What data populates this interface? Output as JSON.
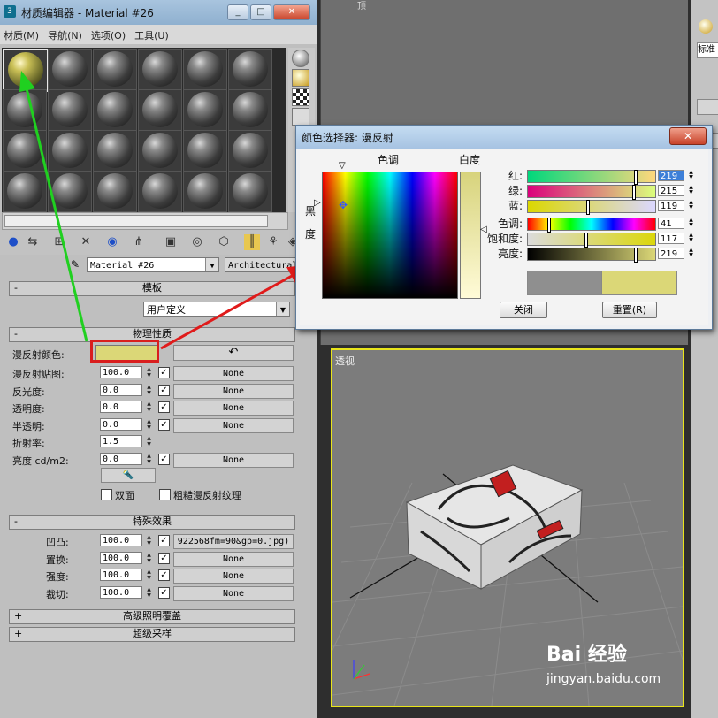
{
  "material_editor": {
    "title": "材质编辑器 - Material #26",
    "menu": [
      "材质(M)",
      "导航(N)",
      "选项(O)",
      "工具(U)"
    ],
    "material_name": "Material #26",
    "material_type": "Architectural",
    "template_rollout": "模板",
    "template_value": "用户定义",
    "physical_rollout": "物理性质",
    "diffuse_color_label": "漫反射颜色:",
    "diffuse_color": "#dbd777",
    "params": [
      {
        "label": "漫反射贴图:",
        "value": "100.0",
        "map": "None"
      },
      {
        "label": "反光度:",
        "value": "0.0",
        "map": "None"
      },
      {
        "label": "透明度:",
        "value": "0.0",
        "map": "None"
      },
      {
        "label": "半透明:",
        "value": "0.0",
        "map": "None"
      },
      {
        "label": "折射率:",
        "value": "1.5",
        "map": ""
      },
      {
        "label": "亮度 cd/m2:",
        "value": "0.0",
        "map": "None"
      }
    ],
    "double_sided": "双面",
    "rough_diffuse": "粗糙漫反射纹理",
    "special_rollout": "特殊效果",
    "special": [
      {
        "label": "凹凸:",
        "value": "100.0",
        "map": "922568fm=90&gp=0.jpg)"
      },
      {
        "label": "置换:",
        "value": "100.0",
        "map": "None"
      },
      {
        "label": "强度:",
        "value": "100.0",
        "map": "None"
      },
      {
        "label": "裁切:",
        "value": "100.0",
        "map": "None"
      }
    ],
    "adv_lighting": "高级照明覆盖",
    "supersampling": "超级采样"
  },
  "viewport": {
    "perspective_label": "透视",
    "top_label": "顶"
  },
  "right_panel": {
    "label": "标准"
  },
  "color_picker": {
    "title": "颜色选择器: 漫反射",
    "hue_label": "色调",
    "whiteness_label": "白度",
    "black_label_1": "黑",
    "black_label_2": "度",
    "channels": [
      {
        "label": "红:",
        "value": "219",
        "gradient": "linear-gradient(to right,#00d77c,#ffd77c)",
        "pos": 0.86
      },
      {
        "label": "绿:",
        "value": "215",
        "gradient": "linear-gradient(to right,#db007c,#dbff7c)",
        "pos": 0.84
      },
      {
        "label": "蓝:",
        "value": "119",
        "gradient": "linear-gradient(to right,#dbd700,#dbd7ff)",
        "pos": 0.47
      }
    ],
    "hsv": [
      {
        "label": "色调:",
        "value": "41",
        "gradient": "linear-gradient(to right,#f00,#ff0,#0f0,#0ff,#00f,#f0f,#f00)",
        "pos": 0.16
      },
      {
        "label": "饱和度:",
        "value": "117",
        "gradient": "linear-gradient(to right,#dbdbdb,#dbd70a)",
        "pos": 0.46
      },
      {
        "label": "亮度:",
        "value": "219",
        "gradient": "linear-gradient(to right,#000,#dbd777)",
        "pos": 0.86
      }
    ],
    "old_color": "#8f8f8f",
    "new_color": "#dbd777",
    "close_label": "关闭",
    "reset_label": "重置(R)"
  },
  "watermark": {
    "brand": "Bai 经验",
    "url": "jingyan.baidu.com"
  }
}
